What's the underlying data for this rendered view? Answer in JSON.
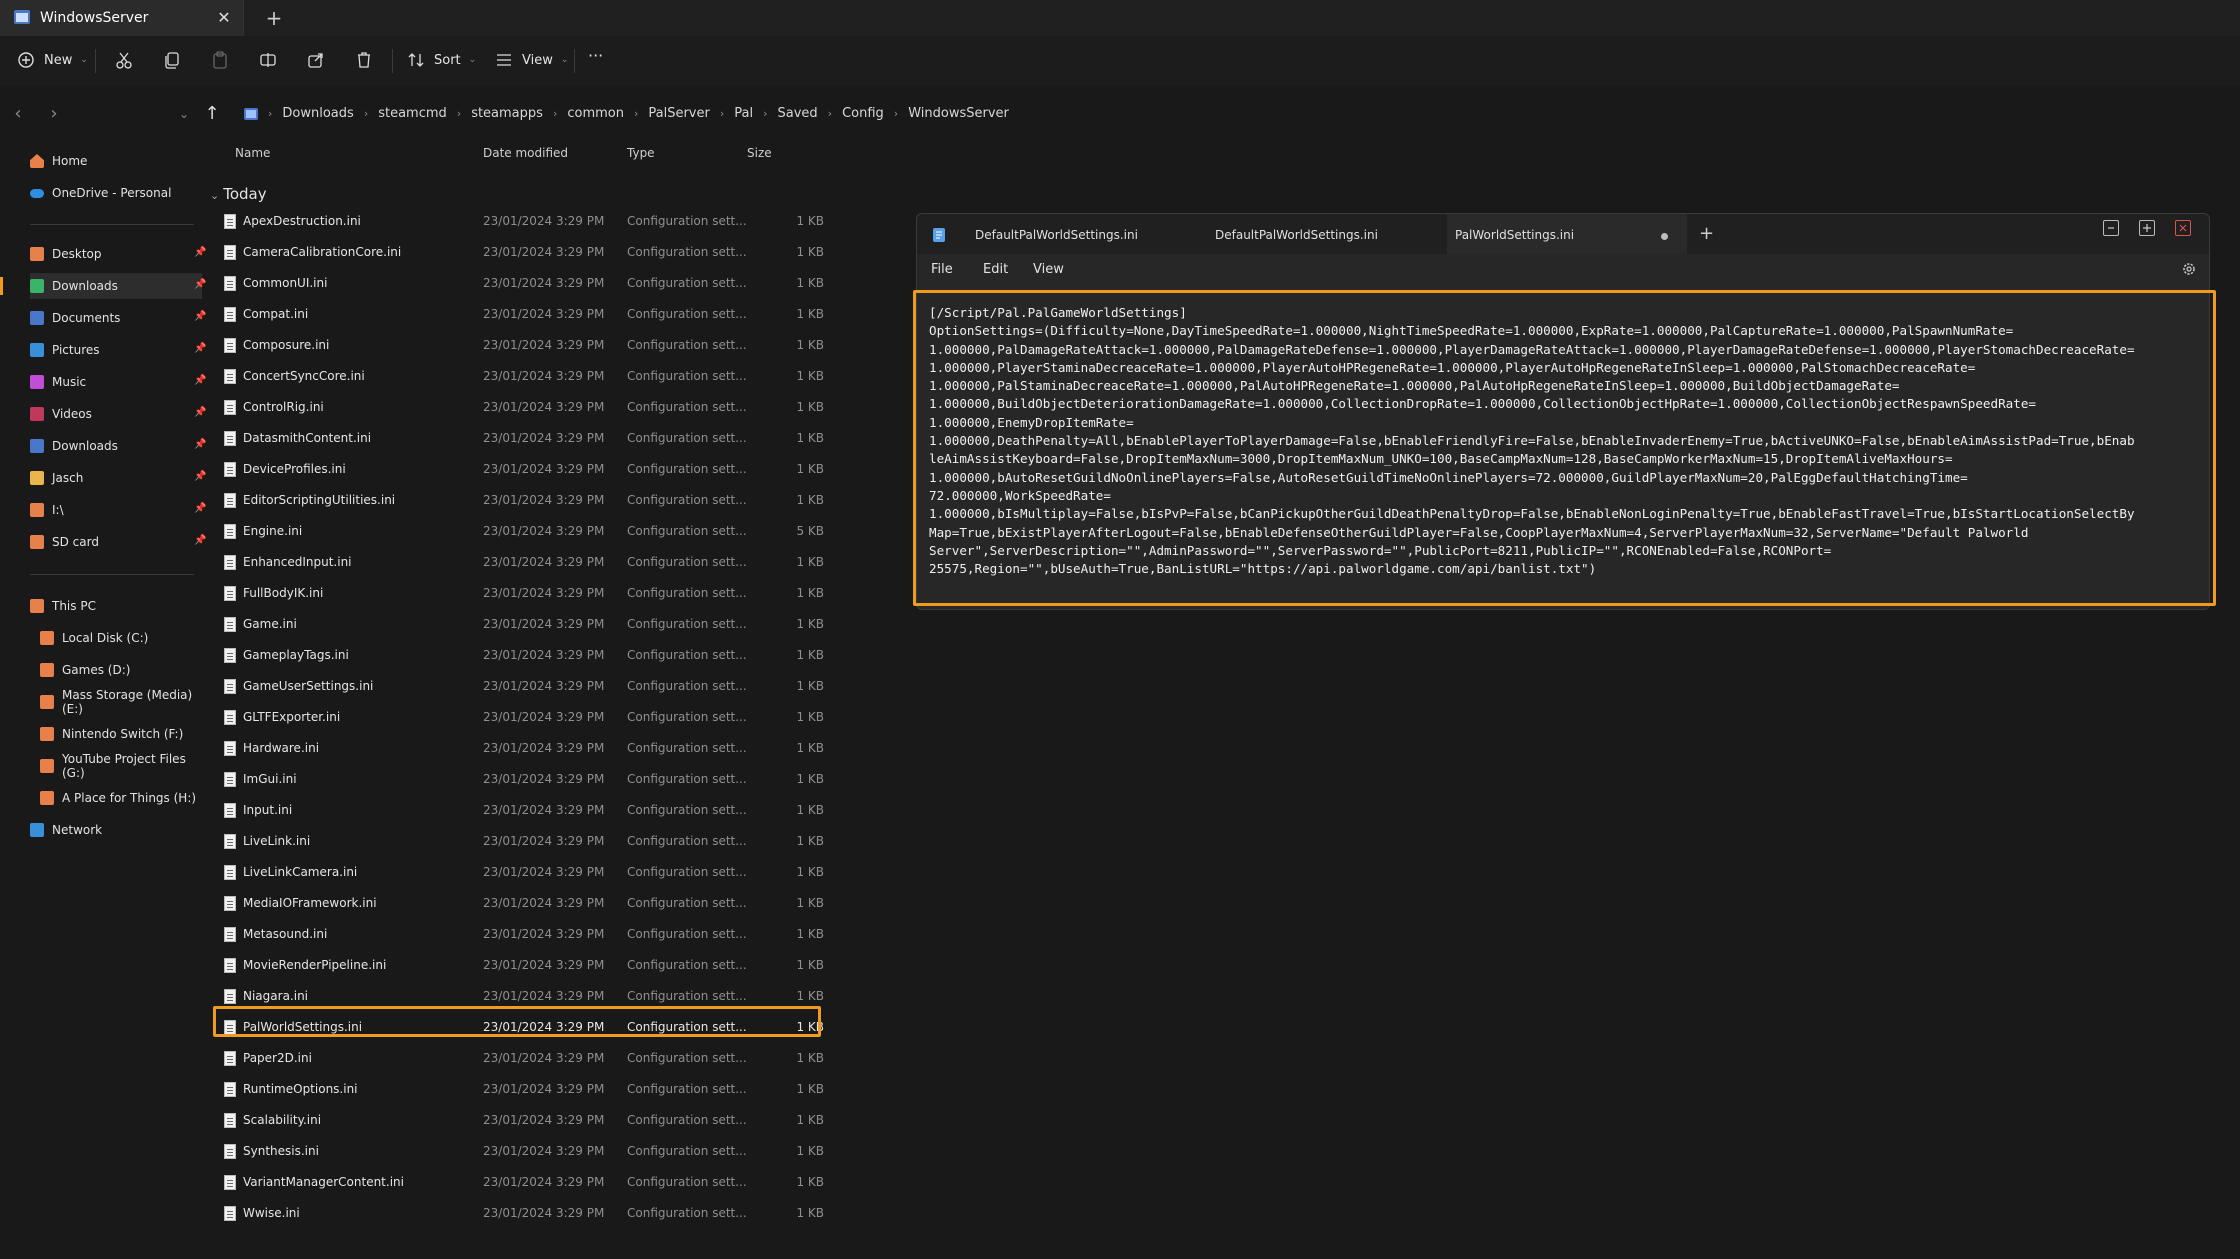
{
  "window": {
    "tab_title": "WindowsServer",
    "close": "✕",
    "new_tab": "+"
  },
  "commandbar": {
    "new": "New",
    "sort": "Sort",
    "view": "View",
    "more": "···"
  },
  "breadcrumb": [
    "Downloads",
    "steamcmd",
    "steamapps",
    "common",
    "PalServer",
    "Pal",
    "Saved",
    "Config",
    "WindowsServer"
  ],
  "sidebar": {
    "home": "Home",
    "onedrive": "OneDrive - Personal",
    "pinned": [
      "Desktop",
      "Downloads",
      "Documents",
      "Pictures",
      "Music",
      "Videos",
      "Downloads",
      "Jasch",
      "I:\\",
      "SD card"
    ],
    "this_pc": "This PC",
    "drives": [
      "Local Disk (C:)",
      "Games (D:)",
      "Mass Storage (Media) (E:)",
      "Nintendo Switch (F:)",
      "YouTube Project Files (G:)",
      "A Place for Things (H:)"
    ],
    "network": "Network"
  },
  "filelist": {
    "columns": {
      "name": "Name",
      "date": "Date modified",
      "type": "Type",
      "size": "Size"
    },
    "group": "Today",
    "files": [
      {
        "name": "ApexDestruction.ini",
        "date": "23/01/2024 3:29 PM",
        "type": "Configuration sett...",
        "size": "1 KB"
      },
      {
        "name": "CameraCalibrationCore.ini",
        "date": "23/01/2024 3:29 PM",
        "type": "Configuration sett...",
        "size": "1 KB"
      },
      {
        "name": "CommonUI.ini",
        "date": "23/01/2024 3:29 PM",
        "type": "Configuration sett...",
        "size": "1 KB"
      },
      {
        "name": "Compat.ini",
        "date": "23/01/2024 3:29 PM",
        "type": "Configuration sett...",
        "size": "1 KB"
      },
      {
        "name": "Composure.ini",
        "date": "23/01/2024 3:29 PM",
        "type": "Configuration sett...",
        "size": "1 KB"
      },
      {
        "name": "ConcertSyncCore.ini",
        "date": "23/01/2024 3:29 PM",
        "type": "Configuration sett...",
        "size": "1 KB"
      },
      {
        "name": "ControlRig.ini",
        "date": "23/01/2024 3:29 PM",
        "type": "Configuration sett...",
        "size": "1 KB"
      },
      {
        "name": "DatasmithContent.ini",
        "date": "23/01/2024 3:29 PM",
        "type": "Configuration sett...",
        "size": "1 KB"
      },
      {
        "name": "DeviceProfiles.ini",
        "date": "23/01/2024 3:29 PM",
        "type": "Configuration sett...",
        "size": "1 KB"
      },
      {
        "name": "EditorScriptingUtilities.ini",
        "date": "23/01/2024 3:29 PM",
        "type": "Configuration sett...",
        "size": "1 KB"
      },
      {
        "name": "Engine.ini",
        "date": "23/01/2024 3:29 PM",
        "type": "Configuration sett...",
        "size": "5 KB"
      },
      {
        "name": "EnhancedInput.ini",
        "date": "23/01/2024 3:29 PM",
        "type": "Configuration sett...",
        "size": "1 KB"
      },
      {
        "name": "FullBodyIK.ini",
        "date": "23/01/2024 3:29 PM",
        "type": "Configuration sett...",
        "size": "1 KB"
      },
      {
        "name": "Game.ini",
        "date": "23/01/2024 3:29 PM",
        "type": "Configuration sett...",
        "size": "1 KB"
      },
      {
        "name": "GameplayTags.ini",
        "date": "23/01/2024 3:29 PM",
        "type": "Configuration sett...",
        "size": "1 KB"
      },
      {
        "name": "GameUserSettings.ini",
        "date": "23/01/2024 3:29 PM",
        "type": "Configuration sett...",
        "size": "1 KB"
      },
      {
        "name": "GLTFExporter.ini",
        "date": "23/01/2024 3:29 PM",
        "type": "Configuration sett...",
        "size": "1 KB"
      },
      {
        "name": "Hardware.ini",
        "date": "23/01/2024 3:29 PM",
        "type": "Configuration sett...",
        "size": "1 KB"
      },
      {
        "name": "ImGui.ini",
        "date": "23/01/2024 3:29 PM",
        "type": "Configuration sett...",
        "size": "1 KB"
      },
      {
        "name": "Input.ini",
        "date": "23/01/2024 3:29 PM",
        "type": "Configuration sett...",
        "size": "1 KB"
      },
      {
        "name": "LiveLink.ini",
        "date": "23/01/2024 3:29 PM",
        "type": "Configuration sett...",
        "size": "1 KB"
      },
      {
        "name": "LiveLinkCamera.ini",
        "date": "23/01/2024 3:29 PM",
        "type": "Configuration sett...",
        "size": "1 KB"
      },
      {
        "name": "MediaIOFramework.ini",
        "date": "23/01/2024 3:29 PM",
        "type": "Configuration sett...",
        "size": "1 KB"
      },
      {
        "name": "Metasound.ini",
        "date": "23/01/2024 3:29 PM",
        "type": "Configuration sett...",
        "size": "1 KB"
      },
      {
        "name": "MovieRenderPipeline.ini",
        "date": "23/01/2024 3:29 PM",
        "type": "Configuration sett...",
        "size": "1 KB"
      },
      {
        "name": "Niagara.ini",
        "date": "23/01/2024 3:29 PM",
        "type": "Configuration sett...",
        "size": "1 KB"
      },
      {
        "name": "PalWorldSettings.ini",
        "date": "23/01/2024 3:29 PM",
        "type": "Configuration sett...",
        "size": "1 KB"
      },
      {
        "name": "Paper2D.ini",
        "date": "23/01/2024 3:29 PM",
        "type": "Configuration sett...",
        "size": "1 KB"
      },
      {
        "name": "RuntimeOptions.ini",
        "date": "23/01/2024 3:29 PM",
        "type": "Configuration sett...",
        "size": "1 KB"
      },
      {
        "name": "Scalability.ini",
        "date": "23/01/2024 3:29 PM",
        "type": "Configuration sett...",
        "size": "1 KB"
      },
      {
        "name": "Synthesis.ini",
        "date": "23/01/2024 3:29 PM",
        "type": "Configuration sett...",
        "size": "1 KB"
      },
      {
        "name": "VariantManagerContent.ini",
        "date": "23/01/2024 3:29 PM",
        "type": "Configuration sett...",
        "size": "1 KB"
      },
      {
        "name": "Wwise.ini",
        "date": "23/01/2024 3:29 PM",
        "type": "Configuration sett...",
        "size": "1 KB"
      }
    ]
  },
  "notepad": {
    "tabs": [
      "DefaultPalWorldSettings.ini",
      "DefaultPalWorldSettings.ini",
      "PalWorldSettings.ini"
    ],
    "menu": [
      "File",
      "Edit",
      "View"
    ],
    "new_tab": "+",
    "content_lines": [
      "[/Script/Pal.PalGameWorldSettings]",
      "OptionSettings=(Difficulty=None,DayTimeSpeedRate=1.000000,NightTimeSpeedRate=1.000000,ExpRate=1.000000,PalCaptureRate=1.000000,PalSpawnNumRate=",
      "1.000000,PalDamageRateAttack=1.000000,PalDamageRateDefense=1.000000,PlayerDamageRateAttack=1.000000,PlayerDamageRateDefense=1.000000,PlayerStomachDecreaceRate=",
      "1.000000,PlayerStaminaDecreaceRate=1.000000,PlayerAutoHPRegeneRate=1.000000,PlayerAutoHpRegeneRateInSleep=1.000000,PalStomachDecreaceRate=",
      "1.000000,PalStaminaDecreaceRate=1.000000,PalAutoHPRegeneRate=1.000000,PalAutoHpRegeneRateInSleep=1.000000,BuildObjectDamageRate=",
      "1.000000,BuildObjectDeteriorationDamageRate=1.000000,CollectionDropRate=1.000000,CollectionObjectHpRate=1.000000,CollectionObjectRespawnSpeedRate=",
      "1.000000,EnemyDropItemRate=",
      "1.000000,DeathPenalty=All,bEnablePlayerToPlayerDamage=False,bEnableFriendlyFire=False,bEnableInvaderEnemy=True,bActiveUNKO=False,bEnableAimAssistPad=True,bEnab",
      "leAimAssistKeyboard=False,DropItemMaxNum=3000,DropItemMaxNum_UNKO=100,BaseCampMaxNum=128,BaseCampWorkerMaxNum=15,DropItemAliveMaxHours=",
      "1.000000,bAutoResetGuildNoOnlinePlayers=False,AutoResetGuildTimeNoOnlinePlayers=72.000000,GuildPlayerMaxNum=20,PalEggDefaultHatchingTime=",
      "72.000000,WorkSpeedRate=",
      "1.000000,bIsMultiplay=False,bIsPvP=False,bCanPickupOtherGuildDeathPenaltyDrop=False,bEnableNonLoginPenalty=True,bEnableFastTravel=True,bIsStartLocationSelectBy",
      "Map=True,bExistPlayerAfterLogout=False,bEnableDefenseOtherGuildPlayer=False,CoopPlayerMaxNum=4,ServerPlayerMaxNum=32,ServerName=\"Default Palworld",
      "Server\",ServerDescription=\"\",AdminPassword=\"\",ServerPassword=\"\",PublicPort=8211,PublicIP=\"\",RCONEnabled=False,RCONPort=",
      "25575,Region=\"\",bUseAuth=True,BanListURL=\"https://api.palworldgame.com/api/banlist.txt\")"
    ]
  },
  "colors": {
    "highlight": "#f09a1e",
    "folder": "#e8b64c"
  }
}
